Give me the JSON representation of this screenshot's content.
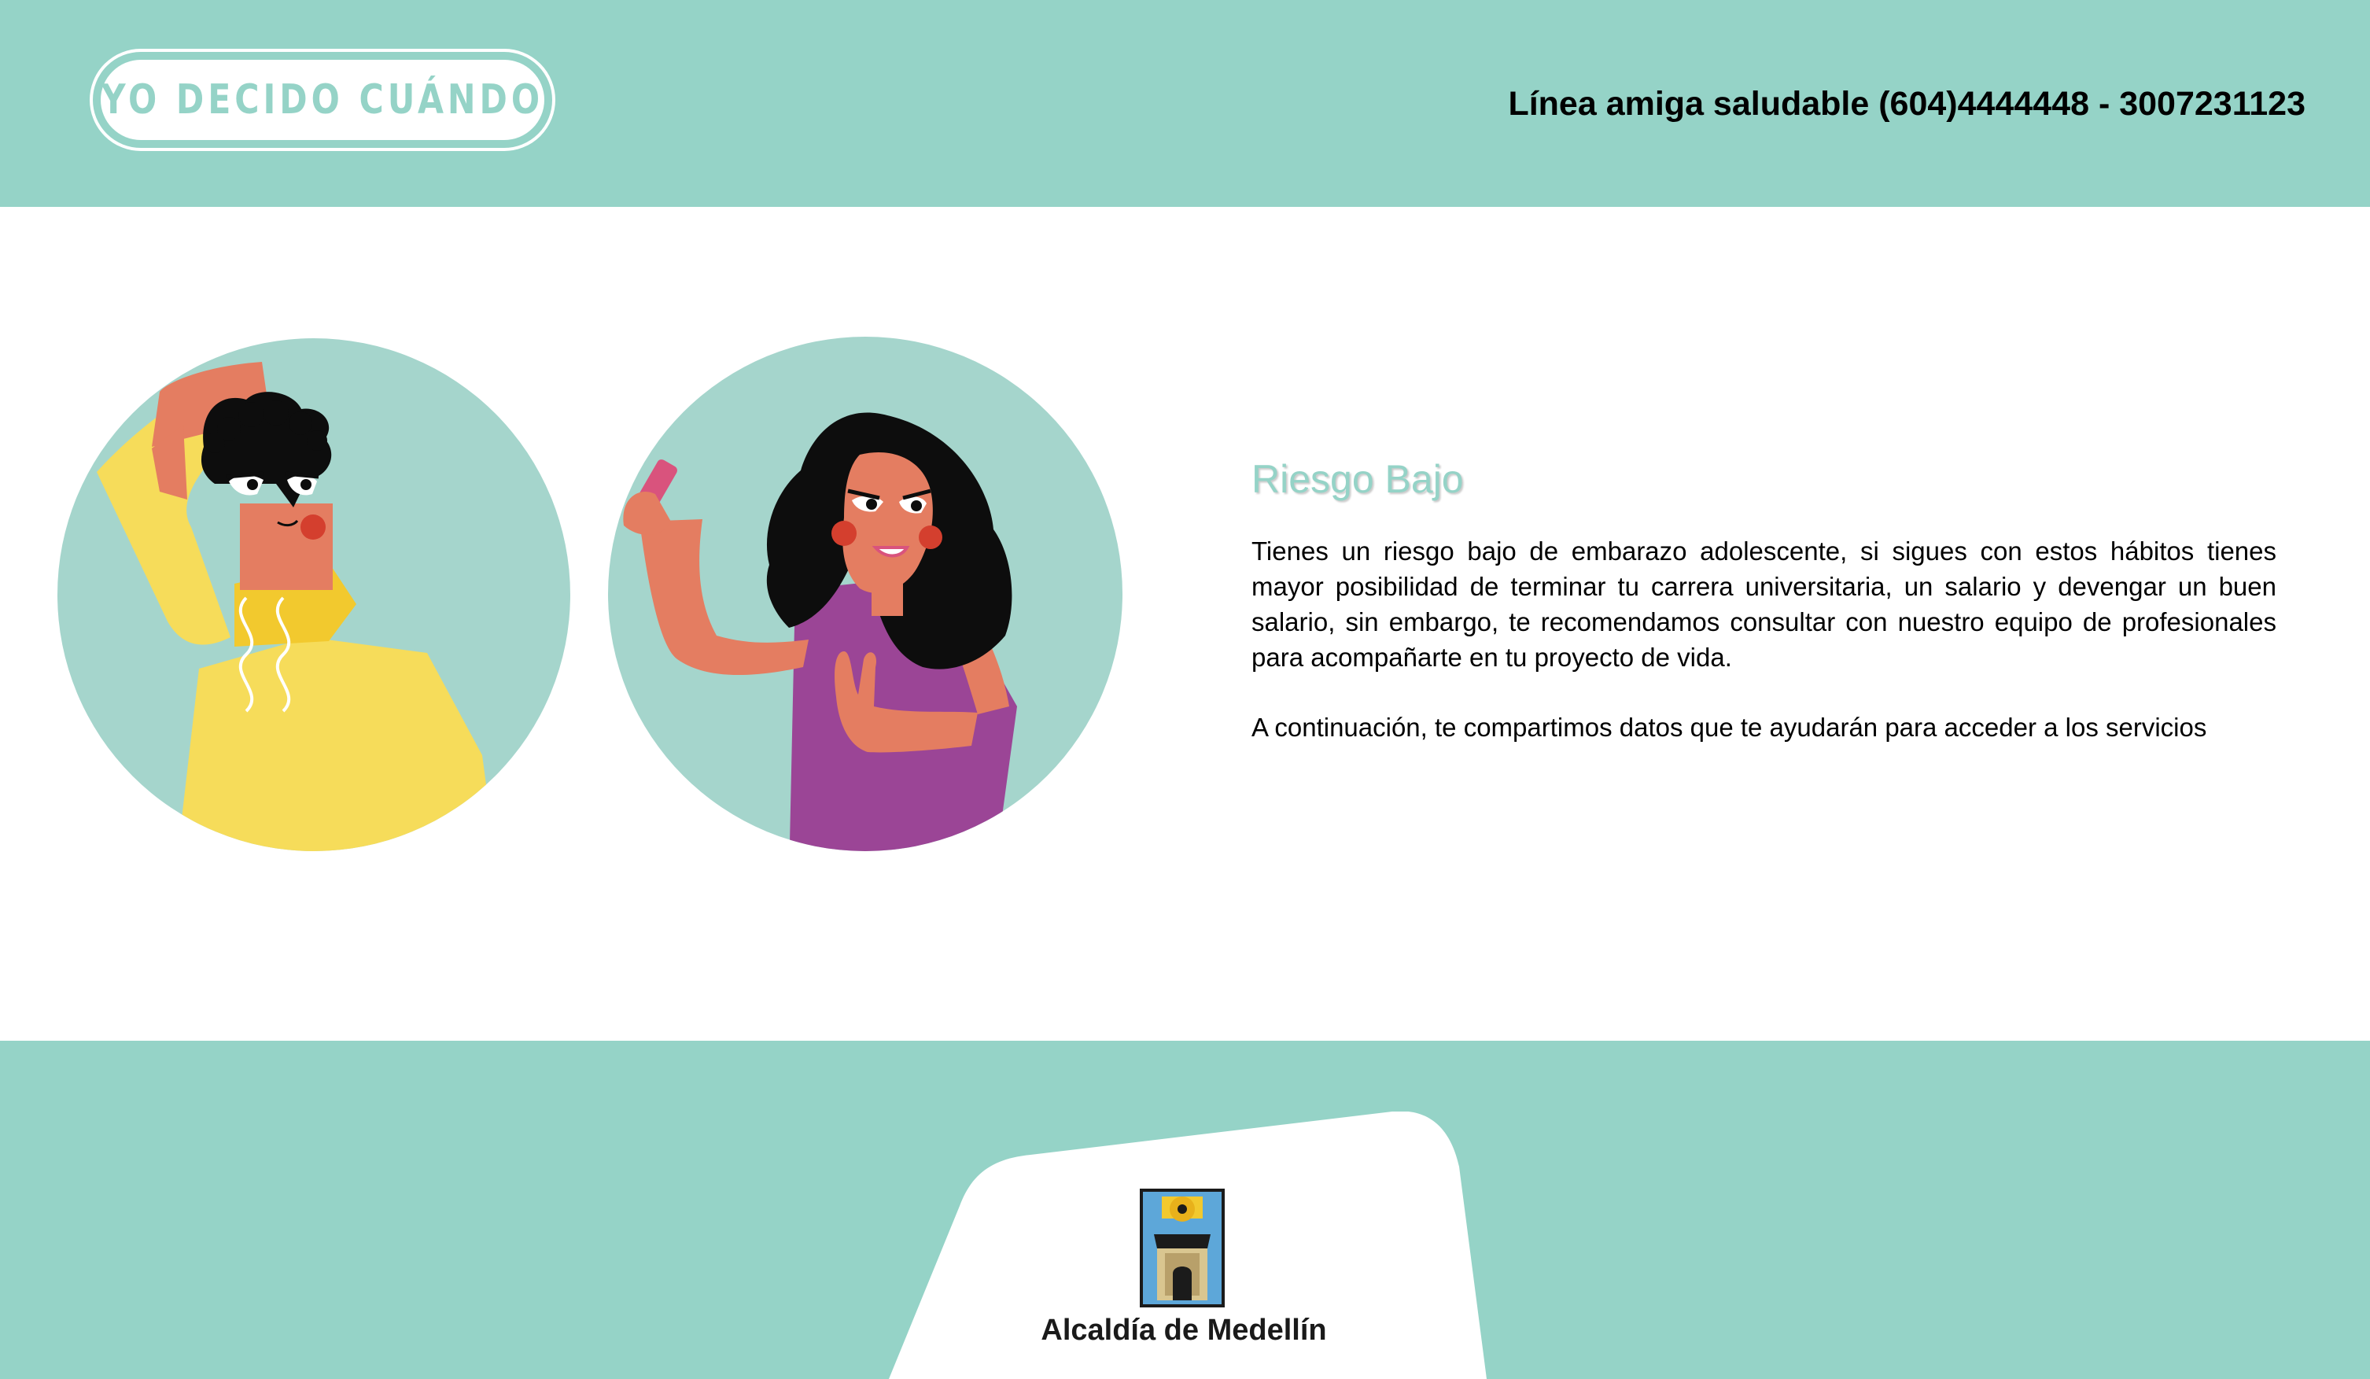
{
  "header": {
    "logo_text": "YO DECIDO CUÁNDO",
    "hotline": "Línea amiga saludable (604)4444448 - 3007231123"
  },
  "content": {
    "title": "Riesgo Bajo",
    "paragraph_1": "Tienes un riesgo bajo de embarazo adolescente, si sigues con estos hábitos tienes mayor posibilidad de terminar tu carrera universitaria, un salario y devengar un buen salario, sin embargo, te recomendamos consultar con nuestro equipo de profesionales para acompañarte en tu proyecto de vida.",
    "paragraph_2": "A continuación, te compartimos datos que te ayudarán para acceder a los servicios"
  },
  "footer": {
    "organization": "Alcaldía de Medellín"
  },
  "colors": {
    "brand_teal": "#95d3c7",
    "illustration_circle": "#a5d5cc",
    "yellow_shirt": "#f6dc5a",
    "purple_top": "#9b4596",
    "skin": "#e47d61",
    "hair": "#0d0d0d"
  },
  "icons": {
    "logo": "yo-decido-cuando-logo",
    "boy_illustration": "boy-scratching-head-illustration",
    "girl_illustration": "girl-holding-phone-illustration",
    "crest": "medellin-coat-of-arms-icon"
  }
}
